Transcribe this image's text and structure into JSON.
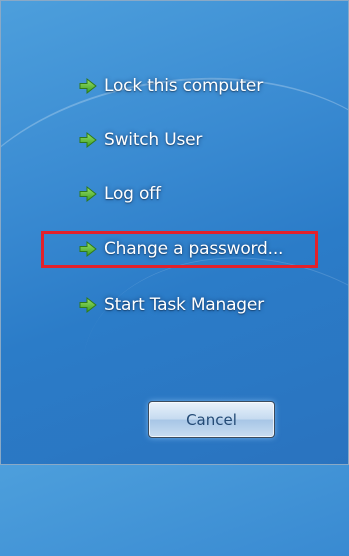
{
  "menu": {
    "items": [
      {
        "label": "Lock this computer",
        "icon": "green-arrow-icon"
      },
      {
        "label": "Switch User",
        "icon": "green-arrow-icon"
      },
      {
        "label": "Log off",
        "icon": "green-arrow-icon"
      },
      {
        "label": "Change a password...",
        "icon": "green-arrow-icon",
        "highlighted": true
      },
      {
        "label": "Start Task Manager",
        "icon": "green-arrow-icon"
      }
    ]
  },
  "cancel_button": {
    "label": "Cancel"
  },
  "colors": {
    "background": "#3a8bd2",
    "arrow": "#5cc23a",
    "highlight_border": "#e3212b",
    "text": "#ffffff"
  }
}
